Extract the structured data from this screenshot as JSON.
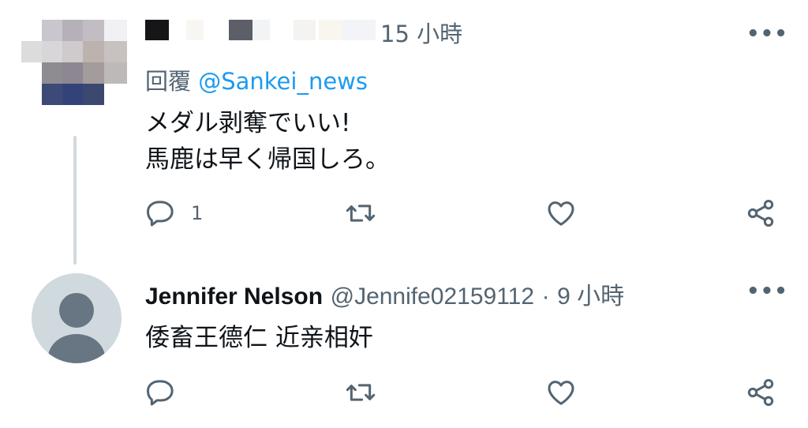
{
  "tweets": [
    {
      "author_name": "",
      "time": "15 小時",
      "reply_prefix": "回覆",
      "reply_mention": "@Sankei_news",
      "lines": [
        "メダル剥奪でいい!",
        "馬鹿は早く帰国しろ。"
      ],
      "reply_count": "1",
      "avatar": "pixelated-avatar"
    },
    {
      "author_name": "Jennifer Nelson",
      "handle": "@Jennife02159112",
      "separator": "·",
      "time": "9 小時",
      "lines": [
        "倭畜王德仁 近亲相奸"
      ],
      "reply_count": "",
      "avatar": "default-profile-avatar"
    }
  ],
  "icons": {
    "more": "more-options-icon",
    "reply": "reply-icon",
    "retweet": "retweet-icon",
    "like": "like-icon",
    "share": "share-icon"
  },
  "colors": {
    "text": "#0f1419",
    "secondary": "#536471",
    "accent": "#1d9bf0",
    "thread_line": "#cfd9de"
  }
}
